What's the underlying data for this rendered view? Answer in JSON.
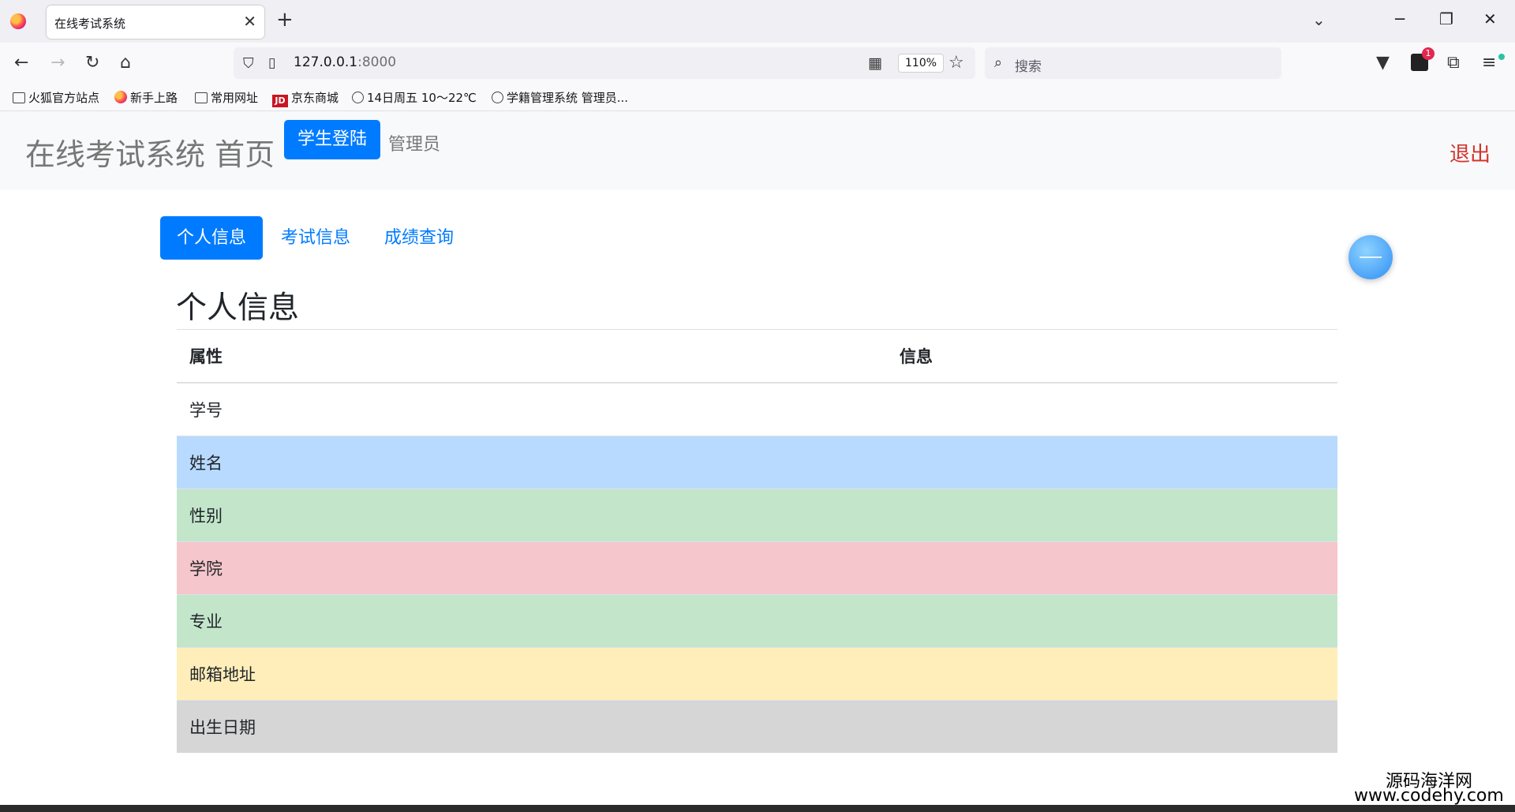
{
  "browser": {
    "tab_title": "在线考试系统",
    "tab_close": "✕",
    "new_tab": "+",
    "list_tabs": "⌄",
    "window_buttons": {
      "minimize": "─",
      "restore": "❐",
      "close": "✕"
    },
    "nav": {
      "back": "←",
      "forward": "→",
      "reload": "↻",
      "home": "⌂"
    },
    "url_host": "127.0.0.1",
    "url_port": ":8000",
    "zoom": "110%",
    "search_placeholder": "搜索",
    "extension_badge": "1",
    "bookmarks": [
      {
        "label": "火狐官方站点",
        "icon": "folder-icon"
      },
      {
        "label": "新手上路",
        "icon": "firefox-icon"
      },
      {
        "label": "常用网址",
        "icon": "folder-icon"
      },
      {
        "label": "京东商城",
        "icon": "jd-icon"
      },
      {
        "label": "14日周五  10～22℃",
        "icon": "globe-icon"
      },
      {
        "label": "学籍管理系统 管理员...",
        "icon": "globe-icon"
      }
    ]
  },
  "header": {
    "brand": "在线考试系统 首页",
    "student_login": "学生登陆",
    "admin": "管理员",
    "logout": "退出"
  },
  "tabs": [
    {
      "label": "个人信息",
      "active": true
    },
    {
      "label": "考试信息",
      "active": false
    },
    {
      "label": "成绩查询",
      "active": false
    }
  ],
  "section_title": "个人信息",
  "table": {
    "headers": [
      "属性",
      "信息"
    ],
    "rows": [
      {
        "attr": "学号",
        "value": "",
        "color": "#ffffff"
      },
      {
        "attr": "姓名",
        "value": "",
        "color": "#b8daff"
      },
      {
        "attr": "性别",
        "value": "",
        "color": "#c3e6cb"
      },
      {
        "attr": "学院",
        "value": "",
        "color": "#f5c6cb"
      },
      {
        "attr": "专业",
        "value": "",
        "color": "#c3e6cb"
      },
      {
        "attr": "邮箱地址",
        "value": "",
        "color": "#ffeeba"
      },
      {
        "attr": "出生日期",
        "value": "",
        "color": "#d6d6d6"
      }
    ]
  },
  "watermark": {
    "line1": "源码海洋网",
    "line2": "www.codehy.com"
  }
}
